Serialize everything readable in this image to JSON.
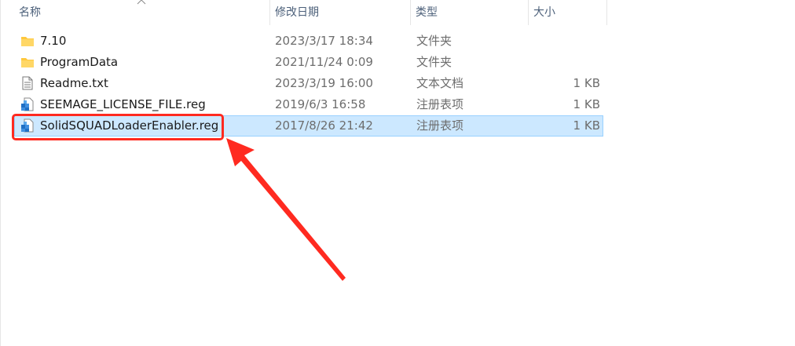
{
  "columns": {
    "name": "名称",
    "date": "修改日期",
    "type": "类型",
    "size": "大小"
  },
  "files": [
    {
      "name": "7.10",
      "date": "2023/3/17 18:34",
      "type": "文件夹",
      "size": "",
      "icon": "folder-icon"
    },
    {
      "name": "ProgramData",
      "date": "2021/11/24 0:09",
      "type": "文件夹",
      "size": "",
      "icon": "folder-icon"
    },
    {
      "name": "Readme.txt",
      "date": "2023/3/19 16:00",
      "type": "文本文档",
      "size": "1 KB",
      "icon": "text-file-icon"
    },
    {
      "name": "SEEMAGE_LICENSE_FILE.reg",
      "date": "2019/6/3 16:58",
      "type": "注册表项",
      "size": "1 KB",
      "icon": "registry-file-icon"
    },
    {
      "name": "SolidSQUADLoaderEnabler.reg",
      "date": "2017/8/26 21:42",
      "type": "注册表项",
      "size": "1 KB",
      "icon": "registry-file-icon"
    }
  ],
  "selected_index": 4,
  "colors": {
    "selection_bg": "#cce8ff",
    "selection_border": "#99d1ff",
    "annotation_red": "#ff2a20",
    "folder_yellow": "#ffc83d"
  }
}
